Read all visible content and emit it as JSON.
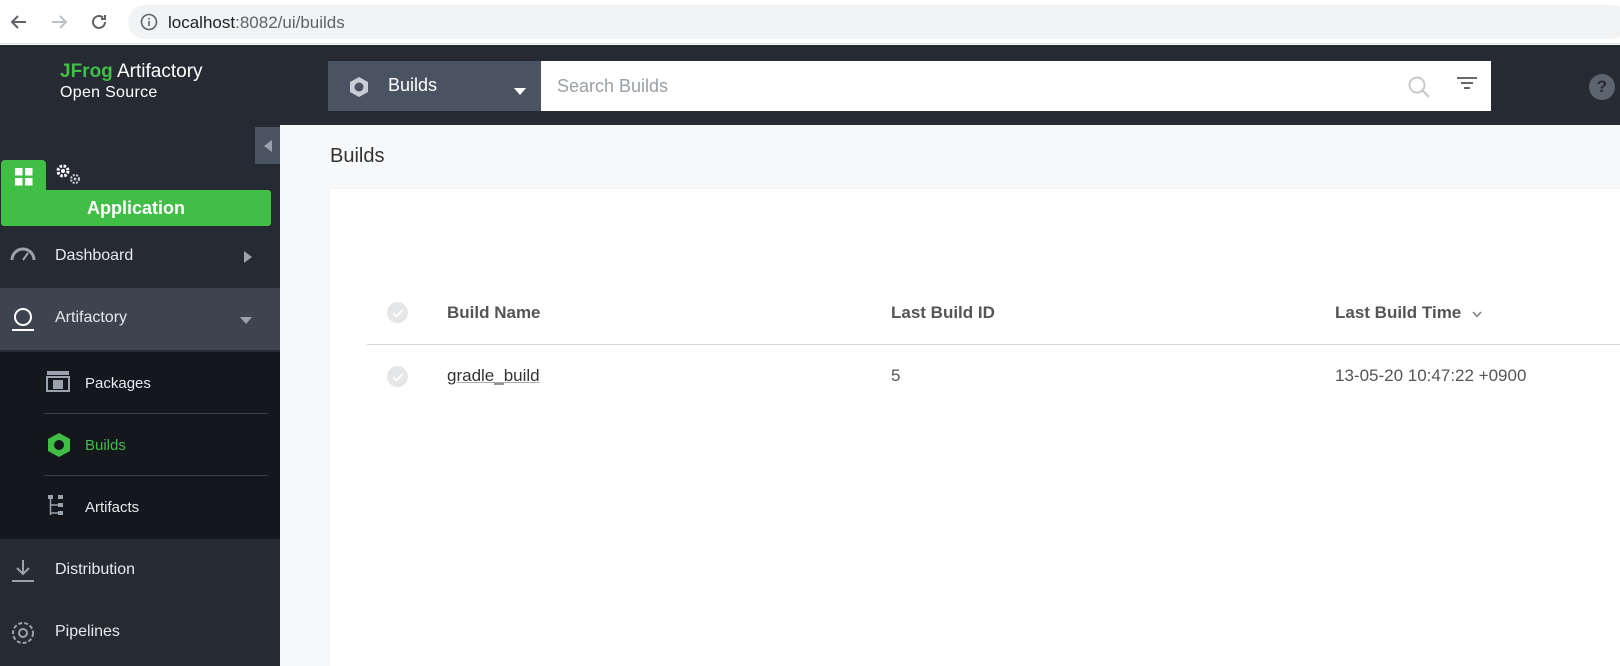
{
  "browser": {
    "url_host": "localhost",
    "url_rest": ":8082/ui/builds"
  },
  "header": {
    "logo_jfrog": "JFrog",
    "logo_product": " Artifactory",
    "logo_sub": "Open Source",
    "scope_label": "Builds",
    "search_placeholder": "Search Builds",
    "help": "?"
  },
  "sidebar": {
    "app_button": "Application",
    "items": [
      {
        "label": "Dashboard"
      },
      {
        "label": "Artifactory"
      },
      {
        "label": "Distribution"
      },
      {
        "label": "Pipelines"
      }
    ],
    "sub_items": [
      {
        "label": "Packages"
      },
      {
        "label": "Builds"
      },
      {
        "label": "Artifacts"
      }
    ]
  },
  "main": {
    "title": "Builds",
    "columns": [
      "Build Name",
      "Last Build ID",
      "Last Build Time"
    ],
    "rows": [
      {
        "name": "gradle_build",
        "id": "5",
        "time": "13-05-20 10:47:22 +0900"
      }
    ]
  },
  "colors": {
    "accent": "#40be46",
    "sidebar_bg": "#262b33",
    "subnav_bg": "#14171c"
  }
}
